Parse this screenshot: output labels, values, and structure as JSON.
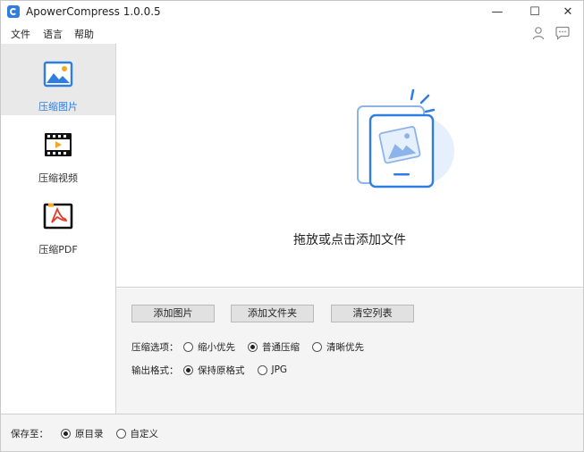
{
  "app": {
    "title": "ApowerCompress 1.0.0.5"
  },
  "window_controls": {
    "minimize": "—",
    "maximize": "☐",
    "close": "✕"
  },
  "menu": {
    "file": "文件",
    "language": "语言",
    "help": "帮助"
  },
  "sidebar": {
    "items": [
      {
        "label": "压缩图片",
        "icon": "image-icon",
        "active": true
      },
      {
        "label": "压缩视频",
        "icon": "video-icon",
        "active": false
      },
      {
        "label": "压缩PDF",
        "icon": "pdf-icon",
        "active": false
      }
    ]
  },
  "dropzone": {
    "text": "拖放或点击添加文件"
  },
  "toolbar": {
    "add_image": "添加图片",
    "add_folder": "添加文件夹",
    "clear_list": "清空列表"
  },
  "compress_options": {
    "label": "压缩选项：",
    "options": [
      {
        "label": "缩小优先",
        "checked": false
      },
      {
        "label": "普通压缩",
        "checked": true
      },
      {
        "label": "清晰优先",
        "checked": false
      }
    ]
  },
  "output_format": {
    "label": "输出格式：",
    "options": [
      {
        "label": "保持原格式",
        "checked": true
      },
      {
        "label": "JPG",
        "checked": false
      }
    ]
  },
  "save_to": {
    "label": "保存至：",
    "options": [
      {
        "label": "原目录",
        "checked": true
      },
      {
        "label": "自定义",
        "checked": false
      }
    ]
  },
  "colors": {
    "accent": "#2f7de1",
    "sidebar_active_bg": "#e9e9e9",
    "panel_bg": "#f4f4f4"
  }
}
